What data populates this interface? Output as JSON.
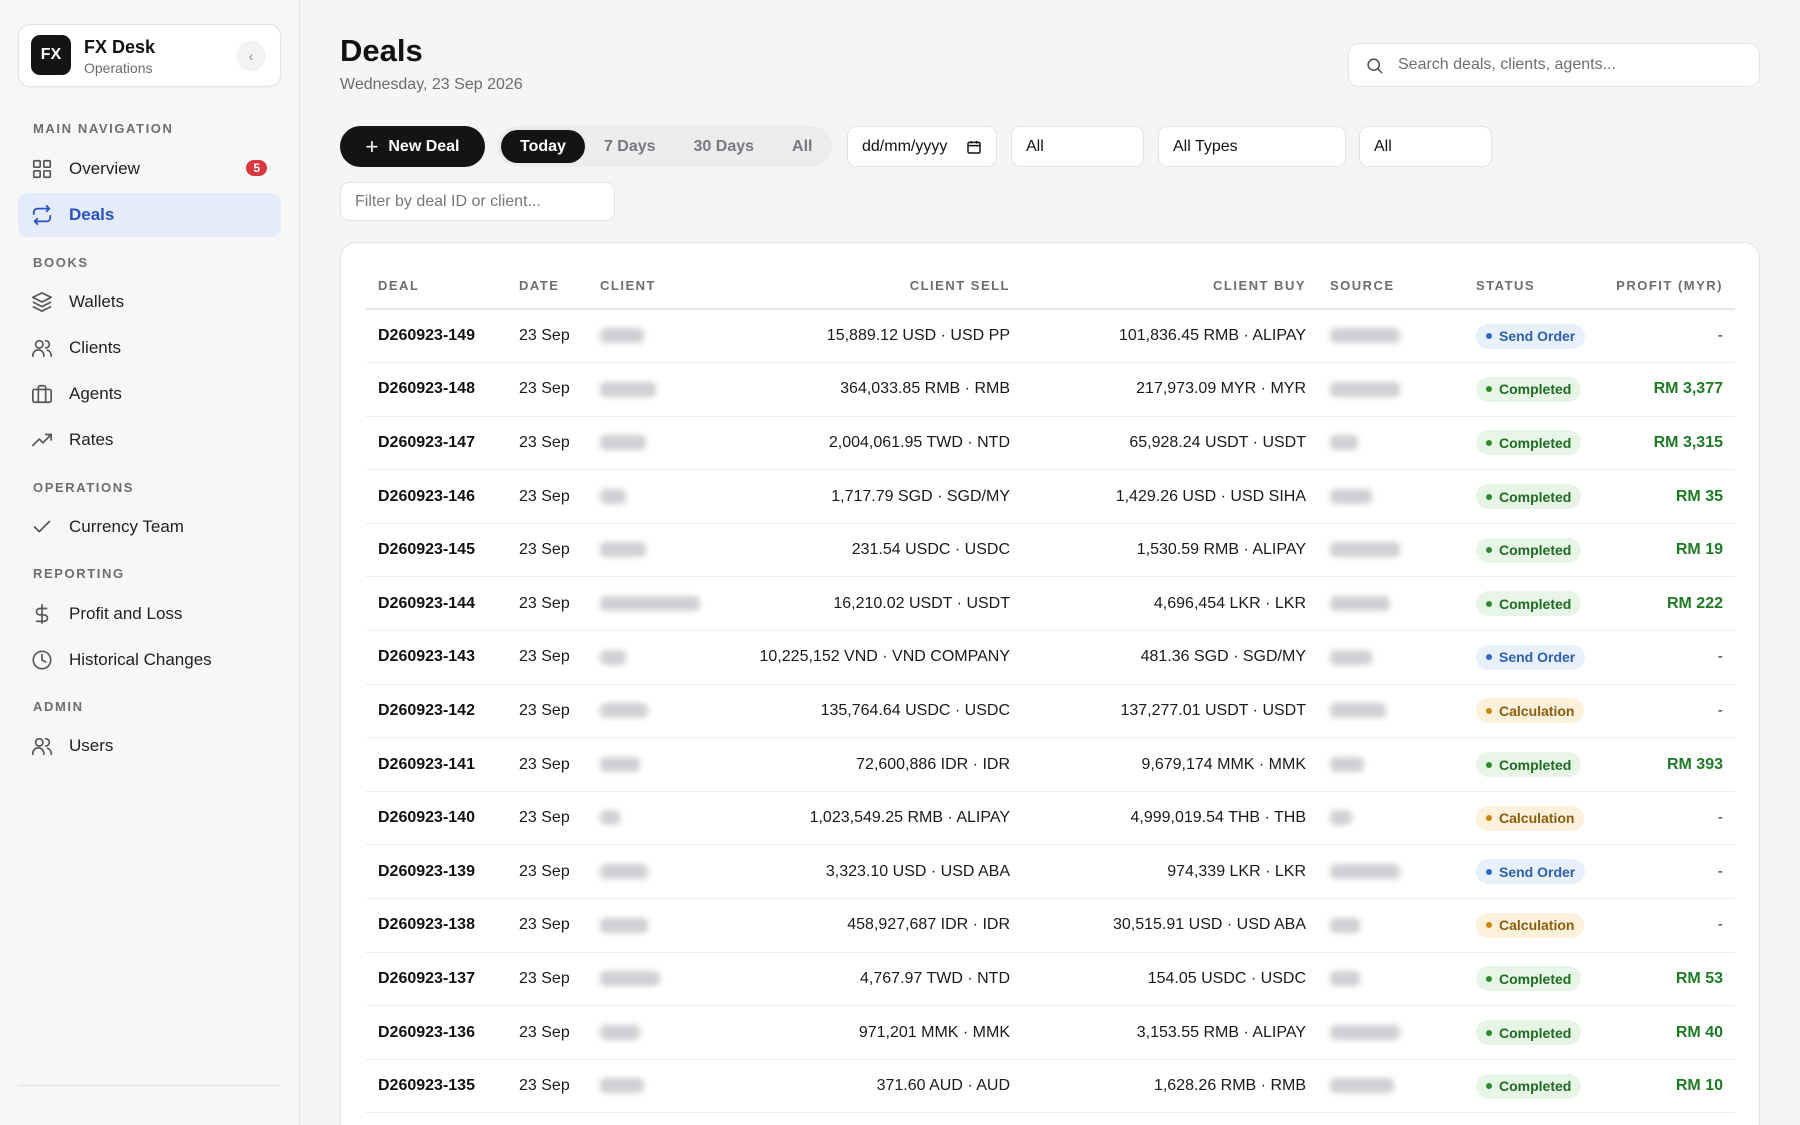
{
  "brand": {
    "logo": "FX",
    "name": "FX Desk",
    "subtitle": "Operations",
    "collapse_icon": "‹"
  },
  "sidebar": {
    "sections": [
      {
        "label": "MAIN NAVIGATION"
      },
      {
        "label": "BOOKS"
      },
      {
        "label": "OPERATIONS"
      },
      {
        "label": "REPORTING"
      },
      {
        "label": "ADMIN"
      }
    ],
    "items": [
      {
        "label": "Overview",
        "icon": "grid-icon",
        "badge": "5"
      },
      {
        "label": "Deals",
        "icon": "swap-icon",
        "active": true
      },
      {
        "label": "Wallets",
        "icon": "layers-icon"
      },
      {
        "label": "Clients",
        "icon": "users-icon"
      },
      {
        "label": "Agents",
        "icon": "briefcase-icon"
      },
      {
        "label": "Rates",
        "icon": "trending-up-icon"
      },
      {
        "label": "Currency Team",
        "icon": "check-icon"
      },
      {
        "label": "Profit and Loss",
        "icon": "dollar-icon"
      },
      {
        "label": "Historical Changes",
        "icon": "clock-icon"
      },
      {
        "label": "Users",
        "icon": "users-icon"
      }
    ]
  },
  "header": {
    "title": "Deals",
    "date": "Wednesday, 23 Sep 2026",
    "search_placeholder": "Search deals, clients, agents..."
  },
  "toolbar": {
    "new_deal_label": "New Deal",
    "ranges": [
      "Today",
      "7 Days",
      "30 Days",
      "All"
    ],
    "active_range": "Today",
    "date_placeholder": "dd/mm/yyyy",
    "select_1": "All",
    "select_types": "All Types",
    "select_3": "All",
    "filter_placeholder": "Filter by deal ID or client..."
  },
  "table": {
    "columns": [
      "DEAL",
      "DATE",
      "CLIENT",
      "CLIENT SELL",
      "CLIENT BUY",
      "SOURCE",
      "STATUS",
      "PROFIT (MYR)"
    ],
    "rows": [
      {
        "deal": "D260923-149",
        "date": "23 Sep",
        "sell": "15,889.12 USD · USD PP",
        "buy": "101,836.45 RMB · ALIPAY",
        "status": "Send Order",
        "status_kind": "send",
        "profit": "-"
      },
      {
        "deal": "D260923-148",
        "date": "23 Sep",
        "sell": "364,033.85 RMB · RMB",
        "buy": "217,973.09 MYR · MYR",
        "status": "Completed",
        "status_kind": "completed",
        "profit": "RM 3,377"
      },
      {
        "deal": "D260923-147",
        "date": "23 Sep",
        "sell": "2,004,061.95 TWD · NTD",
        "buy": "65,928.24 USDT · USDT",
        "status": "Completed",
        "status_kind": "completed",
        "profit": "RM 3,315"
      },
      {
        "deal": "D260923-146",
        "date": "23 Sep",
        "sell": "1,717.79 SGD · SGD/MY",
        "buy": "1,429.26 USD · USD SIHA",
        "status": "Completed",
        "status_kind": "completed",
        "profit": "RM 35"
      },
      {
        "deal": "D260923-145",
        "date": "23 Sep",
        "sell": "231.54 USDC · USDC",
        "buy": "1,530.59 RMB · ALIPAY",
        "status": "Completed",
        "status_kind": "completed",
        "profit": "RM 19"
      },
      {
        "deal": "D260923-144",
        "date": "23 Sep",
        "sell": "16,210.02 USDT · USDT",
        "buy": "4,696,454 LKR · LKR",
        "status": "Completed",
        "status_kind": "completed",
        "profit": "RM 222"
      },
      {
        "deal": "D260923-143",
        "date": "23 Sep",
        "sell": "10,225,152 VND · VND COMPANY",
        "buy": "481.36 SGD · SGD/MY",
        "status": "Send Order",
        "status_kind": "send",
        "profit": "-"
      },
      {
        "deal": "D260923-142",
        "date": "23 Sep",
        "sell": "135,764.64 USDC · USDC",
        "buy": "137,277.01 USDT · USDT",
        "status": "Calculation",
        "status_kind": "calc",
        "profit": "-"
      },
      {
        "deal": "D260923-141",
        "date": "23 Sep",
        "sell": "72,600,886 IDR · IDR",
        "buy": "9,679,174 MMK · MMK",
        "status": "Completed",
        "status_kind": "completed",
        "profit": "RM 393"
      },
      {
        "deal": "D260923-140",
        "date": "23 Sep",
        "sell": "1,023,549.25 RMB · ALIPAY",
        "buy": "4,999,019.54 THB · THB",
        "status": "Calculation",
        "status_kind": "calc",
        "profit": "-"
      },
      {
        "deal": "D260923-139",
        "date": "23 Sep",
        "sell": "3,323.10 USD · USD ABA",
        "buy": "974,339 LKR · LKR",
        "status": "Send Order",
        "status_kind": "send",
        "profit": "-"
      },
      {
        "deal": "D260923-138",
        "date": "23 Sep",
        "sell": "458,927,687 IDR · IDR",
        "buy": "30,515.91 USD · USD ABA",
        "status": "Calculation",
        "status_kind": "calc",
        "profit": "-"
      },
      {
        "deal": "D260923-137",
        "date": "23 Sep",
        "sell": "4,767.97 TWD · NTD",
        "buy": "154.05 USDC · USDC",
        "status": "Completed",
        "status_kind": "completed",
        "profit": "RM 53"
      },
      {
        "deal": "D260923-136",
        "date": "23 Sep",
        "sell": "971,201 MMK · MMK",
        "buy": "3,153.55 RMB · ALIPAY",
        "status": "Completed",
        "status_kind": "completed",
        "profit": "RM 40"
      },
      {
        "deal": "D260923-135",
        "date": "23 Sep",
        "sell": "371.60 AUD · AUD",
        "buy": "1,628.26 RMB · RMB",
        "status": "Completed",
        "status_kind": "completed",
        "profit": "RM 10"
      }
    ]
  }
}
